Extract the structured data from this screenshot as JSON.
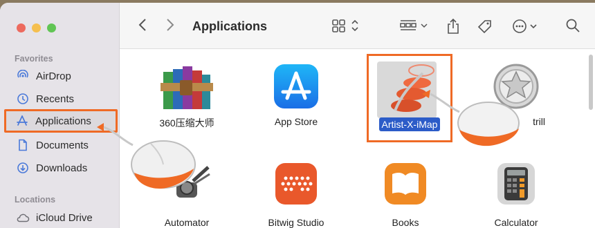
{
  "window": {
    "title": "Applications"
  },
  "sidebar": {
    "favorites_title": "Favorites",
    "items": [
      {
        "label": "AirDrop",
        "icon": "airdrop-icon"
      },
      {
        "label": "Recents",
        "icon": "clock-icon"
      },
      {
        "label": "Applications",
        "icon": "applications-icon",
        "selected": true
      },
      {
        "label": "Documents",
        "icon": "document-icon"
      },
      {
        "label": "Downloads",
        "icon": "download-icon"
      }
    ],
    "locations_title": "Locations",
    "locations": [
      {
        "label": "iCloud Drive",
        "icon": "cloud-icon"
      }
    ]
  },
  "apps": [
    {
      "label": "360压缩大师",
      "icon": "winrar-books-icon"
    },
    {
      "label": "App Store",
      "icon": "app-store-icon"
    },
    {
      "label": "Artist-X-iMap",
      "icon": "artist-x-imap-icon",
      "selected": true
    },
    {
      "label": "trill",
      "icon": "star-badge-icon"
    },
    {
      "label": "Automator",
      "icon": "automator-icon"
    },
    {
      "label": "Bitwig Studio",
      "icon": "bitwig-icon"
    },
    {
      "label": "Books",
      "icon": "books-icon"
    },
    {
      "label": "Calculator",
      "icon": "calculator-icon"
    }
  ],
  "colors": {
    "accent": "#ef6a25",
    "selection": "#2c5cc8"
  }
}
